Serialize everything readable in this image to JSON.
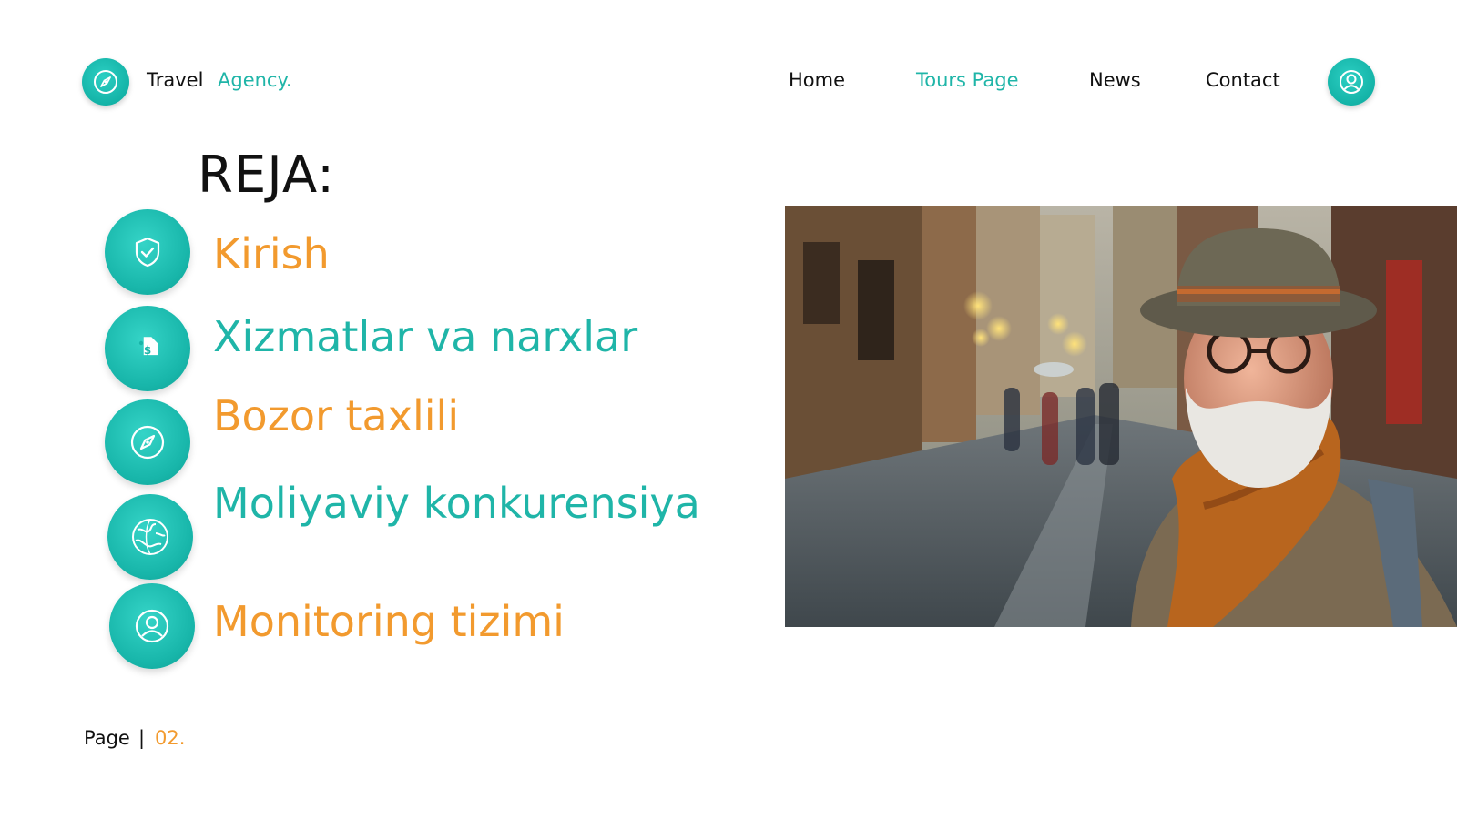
{
  "header": {
    "brand_primary": "Travel",
    "brand_secondary": "Agency.",
    "logo_icon": "compass-icon",
    "nav": [
      {
        "label": "Home",
        "active": false
      },
      {
        "label": "Tours Page",
        "active": true
      },
      {
        "label": "News",
        "active": false
      },
      {
        "label": "Contact",
        "active": false
      }
    ],
    "user_icon": "user-icon"
  },
  "main": {
    "heading": "REJA:",
    "agenda": [
      {
        "label": "Kirish",
        "icon": "shield-check-icon",
        "color": "#f29a2e"
      },
      {
        "label": "Xizmatlar va narxlar",
        "icon": "price-tag-icon",
        "color": "#1fb5a8"
      },
      {
        "label": "Bozor taxlili",
        "icon": "compass-icon",
        "color": "#f29a2e"
      },
      {
        "label": "Moliyaviy konkurensiya",
        "icon": "globe-icon",
        "color": "#1fb5a8"
      },
      {
        "label": "Monitoring tizimi",
        "icon": "user-icon",
        "color": "#f29a2e"
      }
    ],
    "photo": "photo of smiling elderly traveler in hat and scarf on a rainy cobblestone street"
  },
  "footer": {
    "page_label": "Page",
    "separator": "|",
    "page_number": "02."
  },
  "colors": {
    "accent_teal": "#1fb5a8",
    "accent_orange": "#f29a2e",
    "text": "#111111",
    "background": "#ffffff"
  }
}
